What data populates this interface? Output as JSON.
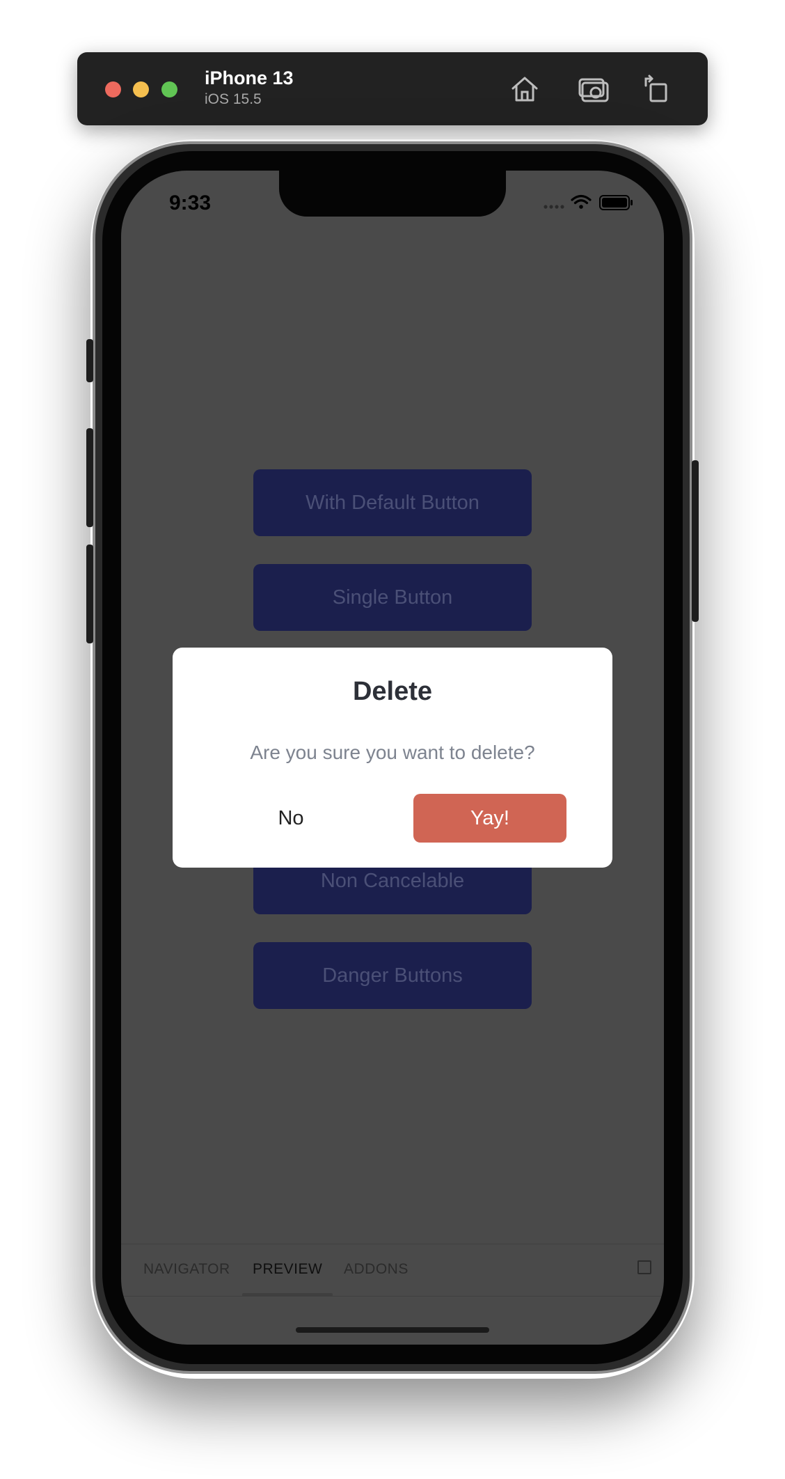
{
  "simulator": {
    "device_name": "iPhone 13",
    "os_version": "iOS 15.5",
    "toolbar_icons": [
      "home-icon",
      "screenshot-camera-icon",
      "rotate-icon"
    ]
  },
  "status_bar": {
    "time": "9:33",
    "icons": [
      "cellular-signal-icon",
      "wifi-icon",
      "battery-icon"
    ]
  },
  "app": {
    "buttons": [
      {
        "label": "With Default Button"
      },
      {
        "label": "Single Button"
      },
      {
        "label": "Non Cancelable"
      },
      {
        "label": "Danger Buttons"
      }
    ],
    "button_color": "#1b1f4d",
    "overlay_color": "#4a4a4a"
  },
  "tab_bar": {
    "tabs": [
      {
        "label": "NAVIGATOR"
      },
      {
        "label": "PREVIEW",
        "active": true
      },
      {
        "label": "ADDONS"
      }
    ]
  },
  "dialog": {
    "title": "Delete",
    "message": "Are you sure you want to delete?",
    "cancel_label": "No",
    "confirm_label": "Yay!",
    "confirm_color": "#d06554"
  }
}
